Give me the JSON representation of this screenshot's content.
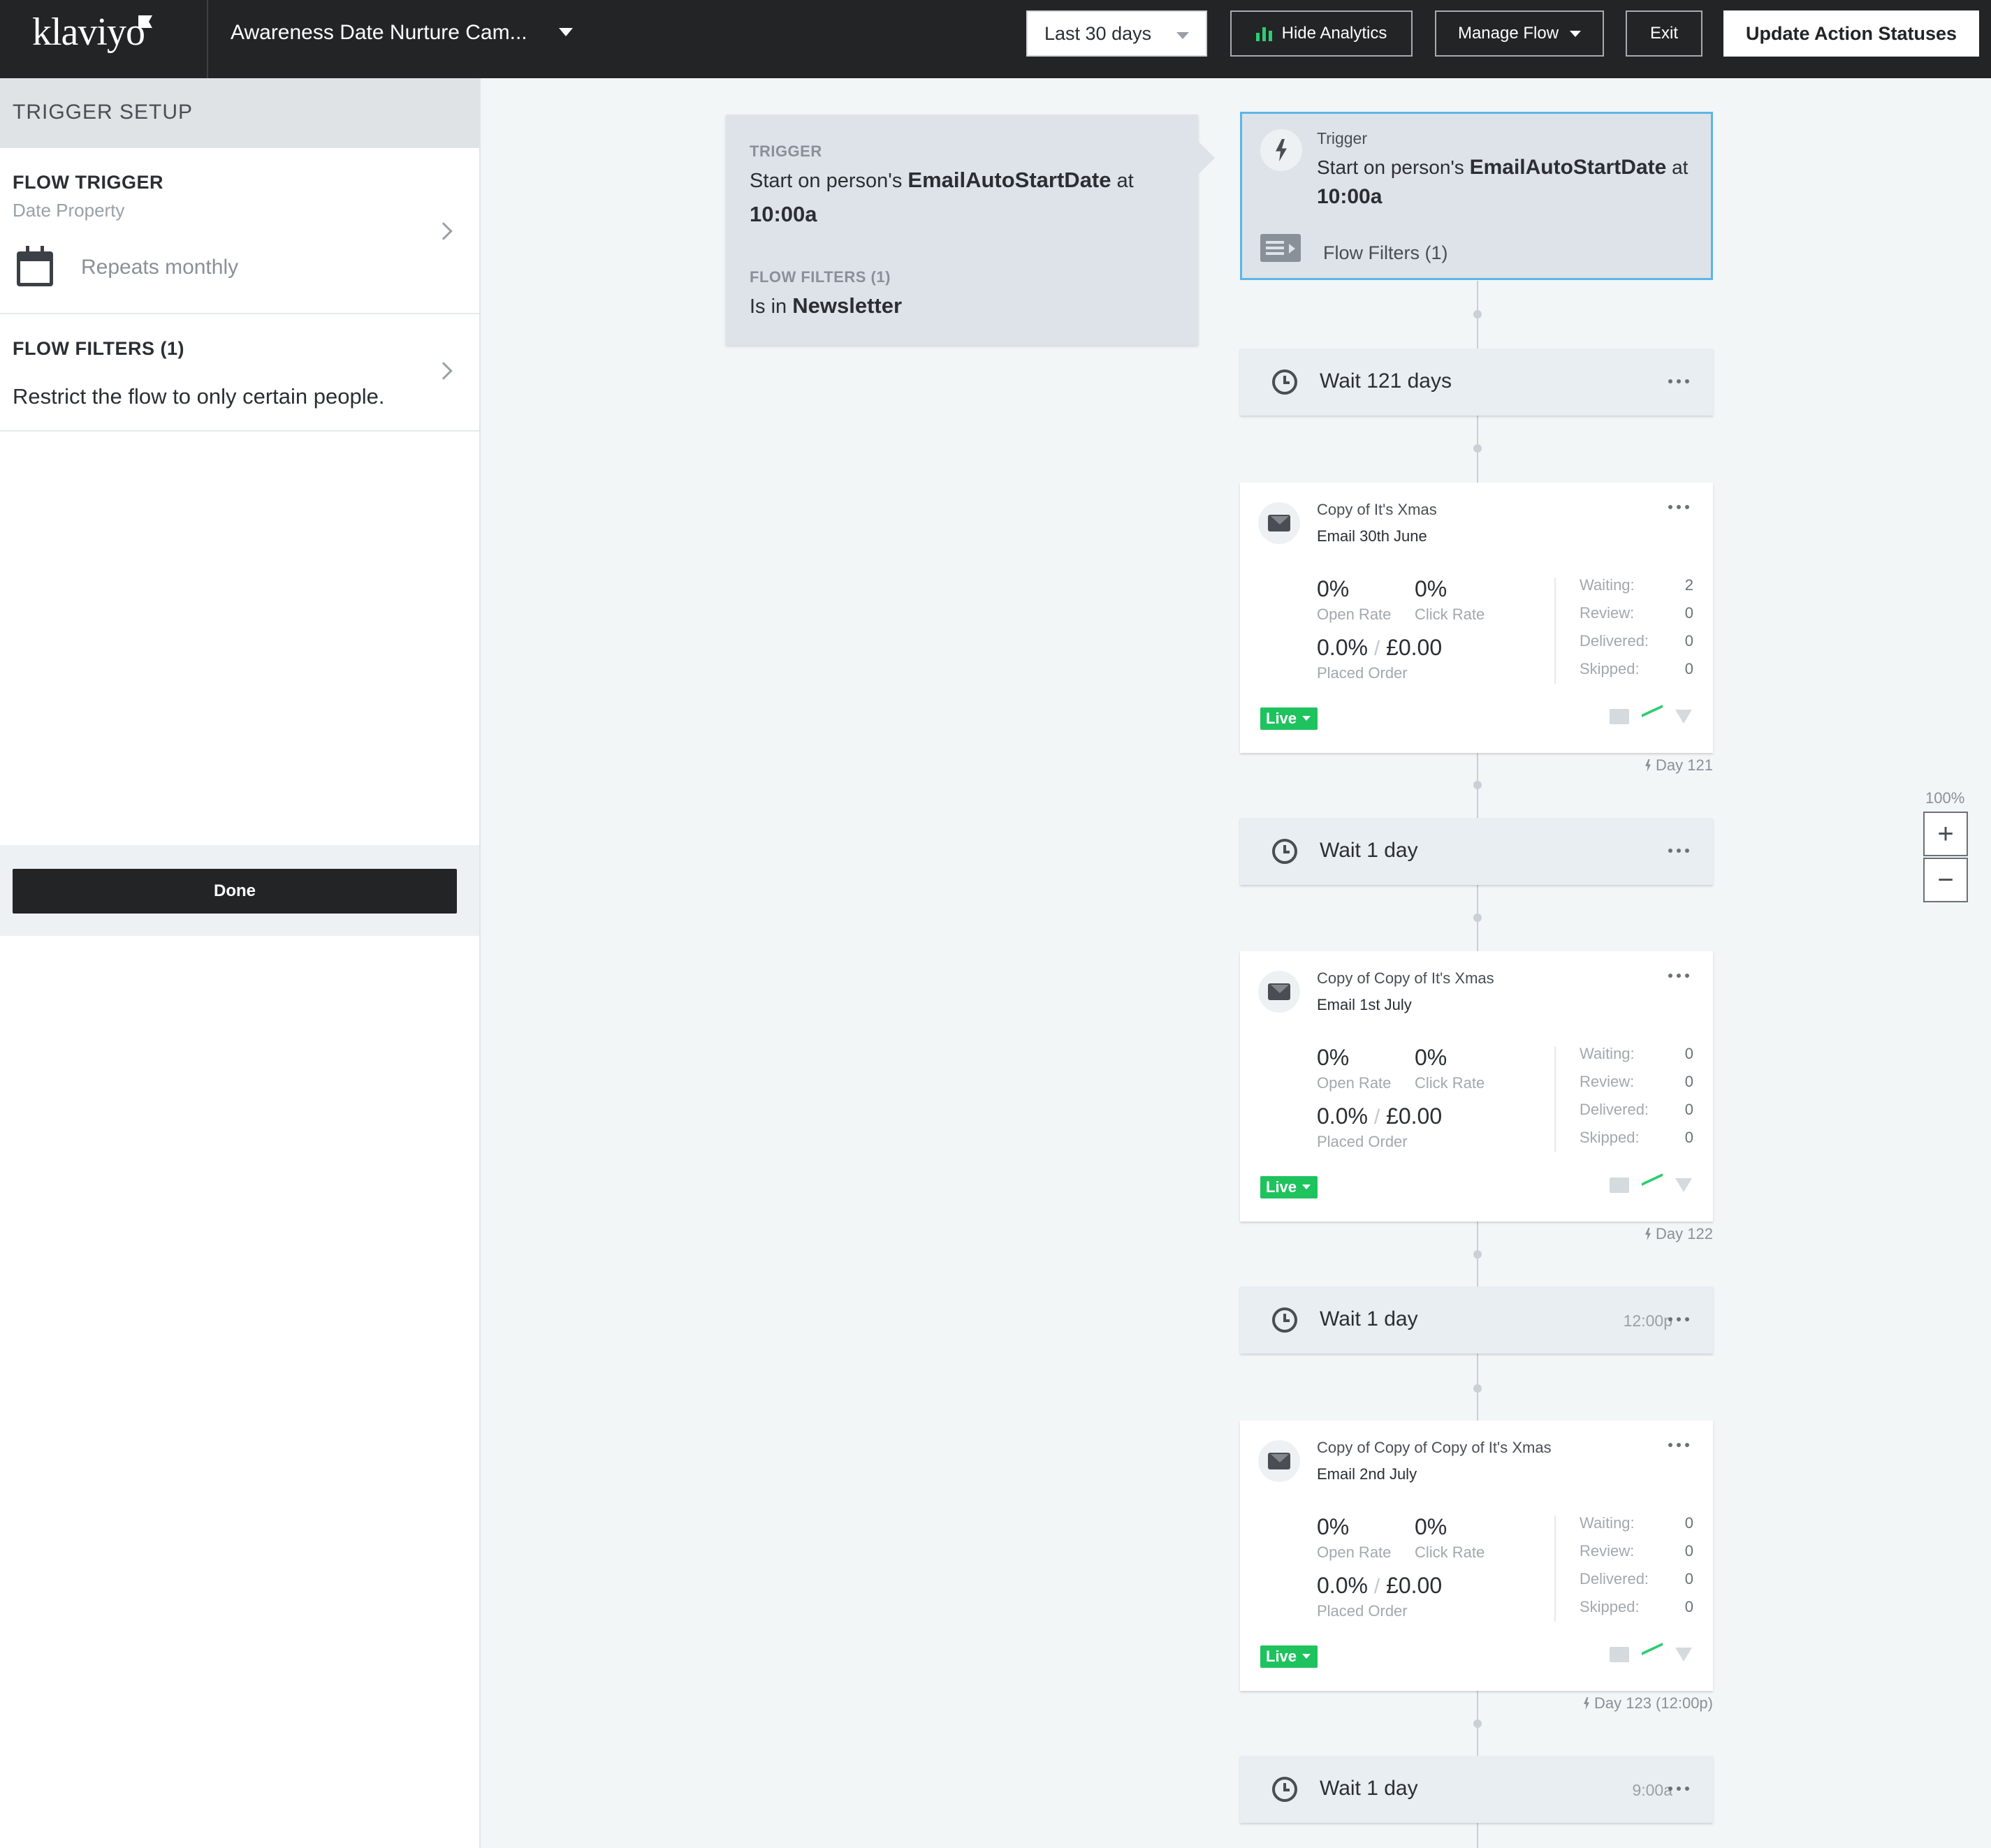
{
  "header": {
    "logo": "klaviyo",
    "flow_title": "Awareness Date Nurture Cam...",
    "date_range": "Last 30 days",
    "hide_analytics": "Hide Analytics",
    "manage_flow": "Manage Flow",
    "exit": "Exit",
    "update_statuses": "Update Action Statuses"
  },
  "sidebar": {
    "header": "TRIGGER SETUP",
    "flow_trigger": {
      "title": "FLOW TRIGGER",
      "subtitle": "Date Property",
      "repeat": "Repeats monthly"
    },
    "flow_filters": {
      "title": "FLOW FILTERS (1)",
      "description": "Restrict the flow to only certain people."
    },
    "done": "Done"
  },
  "popover": {
    "trigger_label": "TRIGGER",
    "trigger_prefix": "Start on person's ",
    "trigger_property": "EmailAutoStartDate",
    "trigger_mid": " at",
    "trigger_time": "10:00a",
    "filters_label": "FLOW FILTERS (1)",
    "filters_prefix": "Is in ",
    "filters_list": "Newsletter"
  },
  "trigger_node": {
    "label": "Trigger",
    "prefix": "Start on person's ",
    "property": "EmailAutoStartDate",
    "mid": " at",
    "time": "10:00a",
    "filters": "Flow Filters (1)"
  },
  "waits": [
    {
      "text": "Wait 121 days",
      "time": ""
    },
    {
      "text": "Wait 1 day",
      "time": ""
    },
    {
      "text": "Wait 1 day",
      "time": "12:00p"
    },
    {
      "text": "Wait 1 day",
      "time": "9:00a"
    }
  ],
  "emails": [
    {
      "title": "Copy of It's Xmas",
      "subject": "Email 30th June",
      "open_rate": "0%",
      "open_label": "Open Rate",
      "click_rate": "0%",
      "click_label": "Click Rate",
      "placed_pct": "0.0%",
      "placed_value": "£0.00",
      "placed_label": "Placed Order",
      "waiting_label": "Waiting:",
      "waiting": "2",
      "review_label": "Review:",
      "review": "0",
      "delivered_label": "Delivered:",
      "delivered": "0",
      "skipped_label": "Skipped:",
      "skipped": "0",
      "status": "Live",
      "day": "Day 121"
    },
    {
      "title": "Copy of Copy of It's Xmas",
      "subject": "Email 1st July",
      "open_rate": "0%",
      "open_label": "Open Rate",
      "click_rate": "0%",
      "click_label": "Click Rate",
      "placed_pct": "0.0%",
      "placed_value": "£0.00",
      "placed_label": "Placed Order",
      "waiting_label": "Waiting:",
      "waiting": "0",
      "review_label": "Review:",
      "review": "0",
      "delivered_label": "Delivered:",
      "delivered": "0",
      "skipped_label": "Skipped:",
      "skipped": "0",
      "status": "Live",
      "day": "Day 122"
    },
    {
      "title": "Copy of Copy of Copy of It's Xmas",
      "subject": "Email 2nd July",
      "open_rate": "0%",
      "open_label": "Open Rate",
      "click_rate": "0%",
      "click_label": "Click Rate",
      "placed_pct": "0.0%",
      "placed_value": "£0.00",
      "placed_label": "Placed Order",
      "waiting_label": "Waiting:",
      "waiting": "0",
      "review_label": "Review:",
      "review": "0",
      "delivered_label": "Delivered:",
      "delivered": "0",
      "skipped_label": "Skipped:",
      "skipped": "0",
      "status": "Live",
      "day": "Day 123 (12:00p)"
    }
  ],
  "zoom": {
    "level": "100%",
    "plus": "+",
    "minus": "−"
  }
}
